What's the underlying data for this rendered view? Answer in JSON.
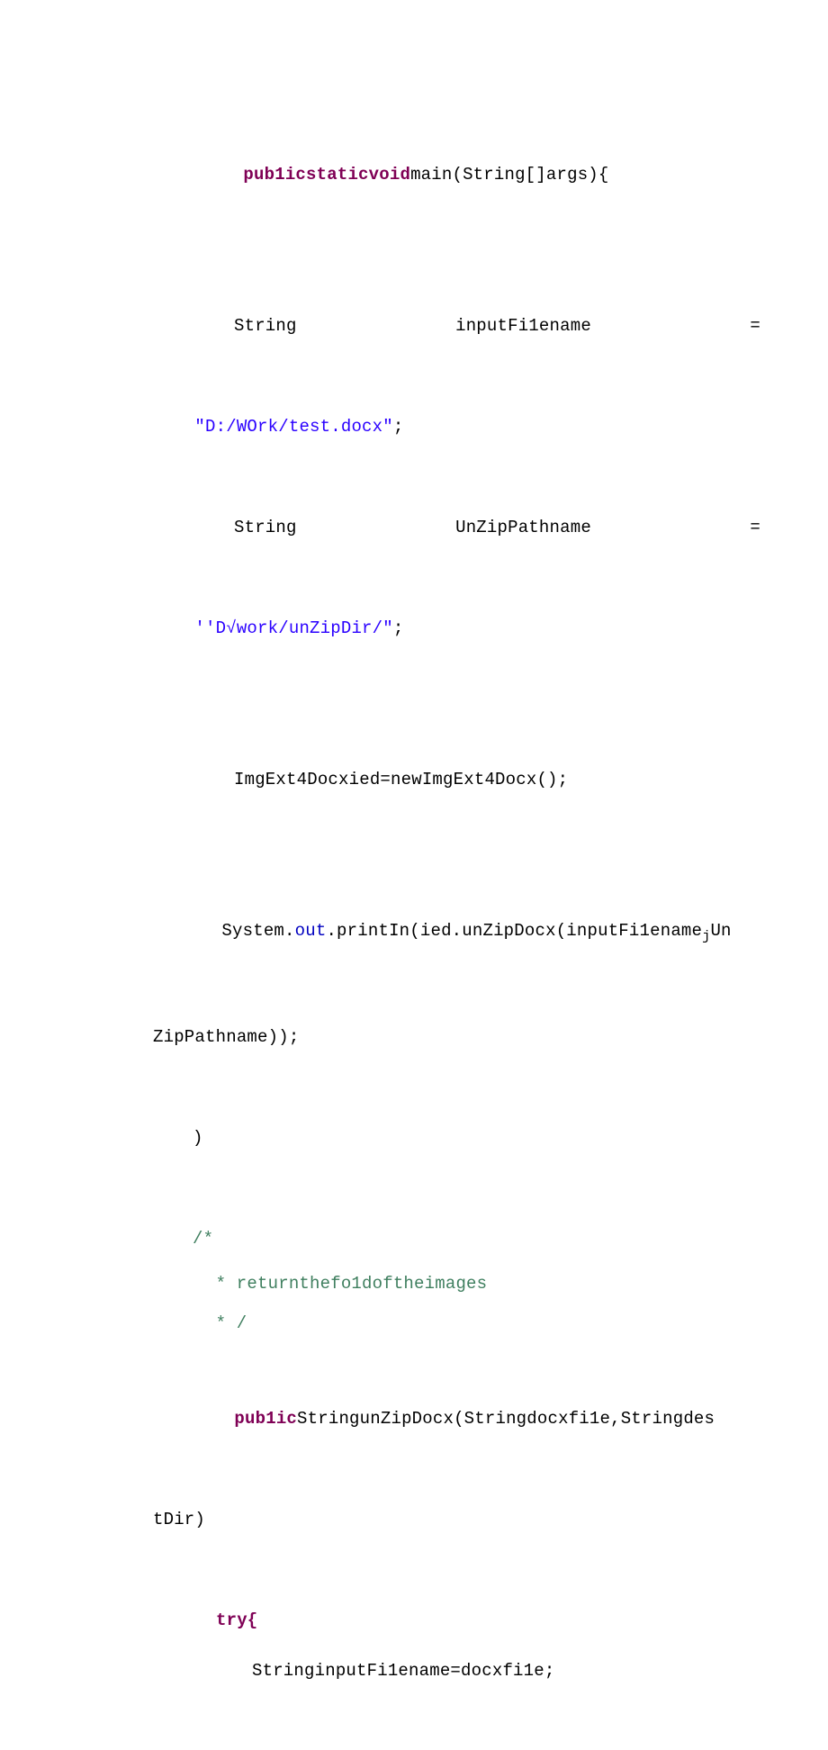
{
  "l1": {
    "a": "pub1icstaticvoid",
    "b": "main(String[]args){"
  },
  "l2": {
    "a": "String",
    "b": "inputFi1ename",
    "c": "="
  },
  "l3": {
    "a": "\"D:/WOrk/test.docx\"",
    "b": ";"
  },
  "l4": {
    "a": "String",
    "b": "UnZipPathname",
    "c": "="
  },
  "l5": {
    "a": "''D√work/unZipDir/\"",
    "b": ";"
  },
  "l6": "ImgExt4Docxied=newImgExt4Docx();",
  "l7a": "System.",
  "l7b": "out",
  "l7c": ".printIn(ied.unZipDocx(inputFi1ename",
  "l7d": "j",
  "l7e": "Un",
  "l8": "ZipPathname));",
  "l9": ")",
  "l10": "/*",
  "l11": " * returnthefo1doftheimages",
  "l12": " * /",
  "l13a": "pub1ic",
  "l13b": "StringunZipDocx(Stringdocxfi1e,Stringdes",
  "l14": "tDir)",
  "l15": "try{",
  "l16": "StringinputFi1ename=docxfi1e;"
}
